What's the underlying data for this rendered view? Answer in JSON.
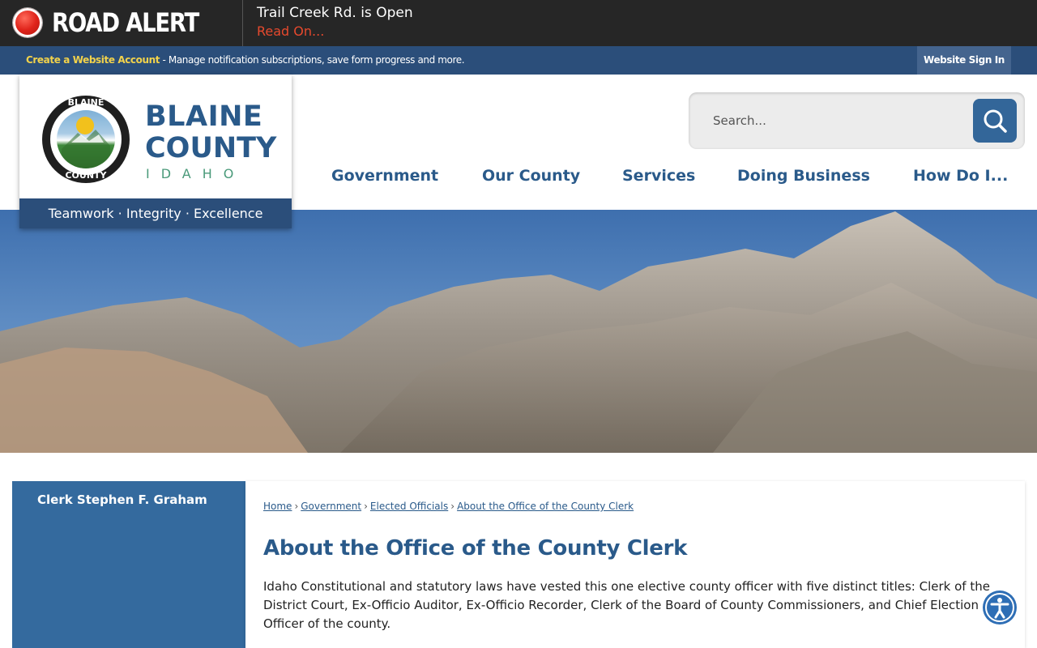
{
  "alert": {
    "title": "ROAD ALERT",
    "message": "Trail Creek Rd. is Open",
    "link": "Read On...",
    "icon": "alert-dot-icon",
    "accent": "#e0241b"
  },
  "account": {
    "create_label": "Create a Website Account",
    "description": " - Manage notification subscriptions, save form progress and more.",
    "signin_label": "Website Sign In"
  },
  "logo": {
    "seal_top": "BLAINE",
    "seal_bottom": "COUNTY",
    "line1": "BLAINE",
    "line2": "COUNTY",
    "line3": "IDAHO",
    "motto": "Teamwork · Integrity · Excellence"
  },
  "search": {
    "placeholder": "Search...",
    "icon": "search-icon"
  },
  "nav": {
    "items": [
      "Government",
      "Our County",
      "Services",
      "Doing Business",
      "How Do I..."
    ]
  },
  "sidebar": {
    "items": [
      "Clerk Stephen F. Graham"
    ]
  },
  "breadcrumb": {
    "items": [
      "Home",
      "Government",
      "Elected Officials",
      "About the Office of the County Clerk"
    ]
  },
  "main": {
    "title": "About the Office of the County Clerk",
    "body": "Idaho Constitutional and statutory laws have vested this one elective county officer with five distinct titles: Clerk of the District Court, Ex-Officio Auditor, Ex-Officio Recorder, Clerk of the Board of County Commissioners, and Chief Election Officer of the county."
  },
  "colors": {
    "brand_blue": "#2b4e7a",
    "heading_blue": "#2a5a8a",
    "sidebar_blue": "#346a9e",
    "alert_link": "#e6492d"
  },
  "accessibility": {
    "icon": "accessibility-icon"
  }
}
